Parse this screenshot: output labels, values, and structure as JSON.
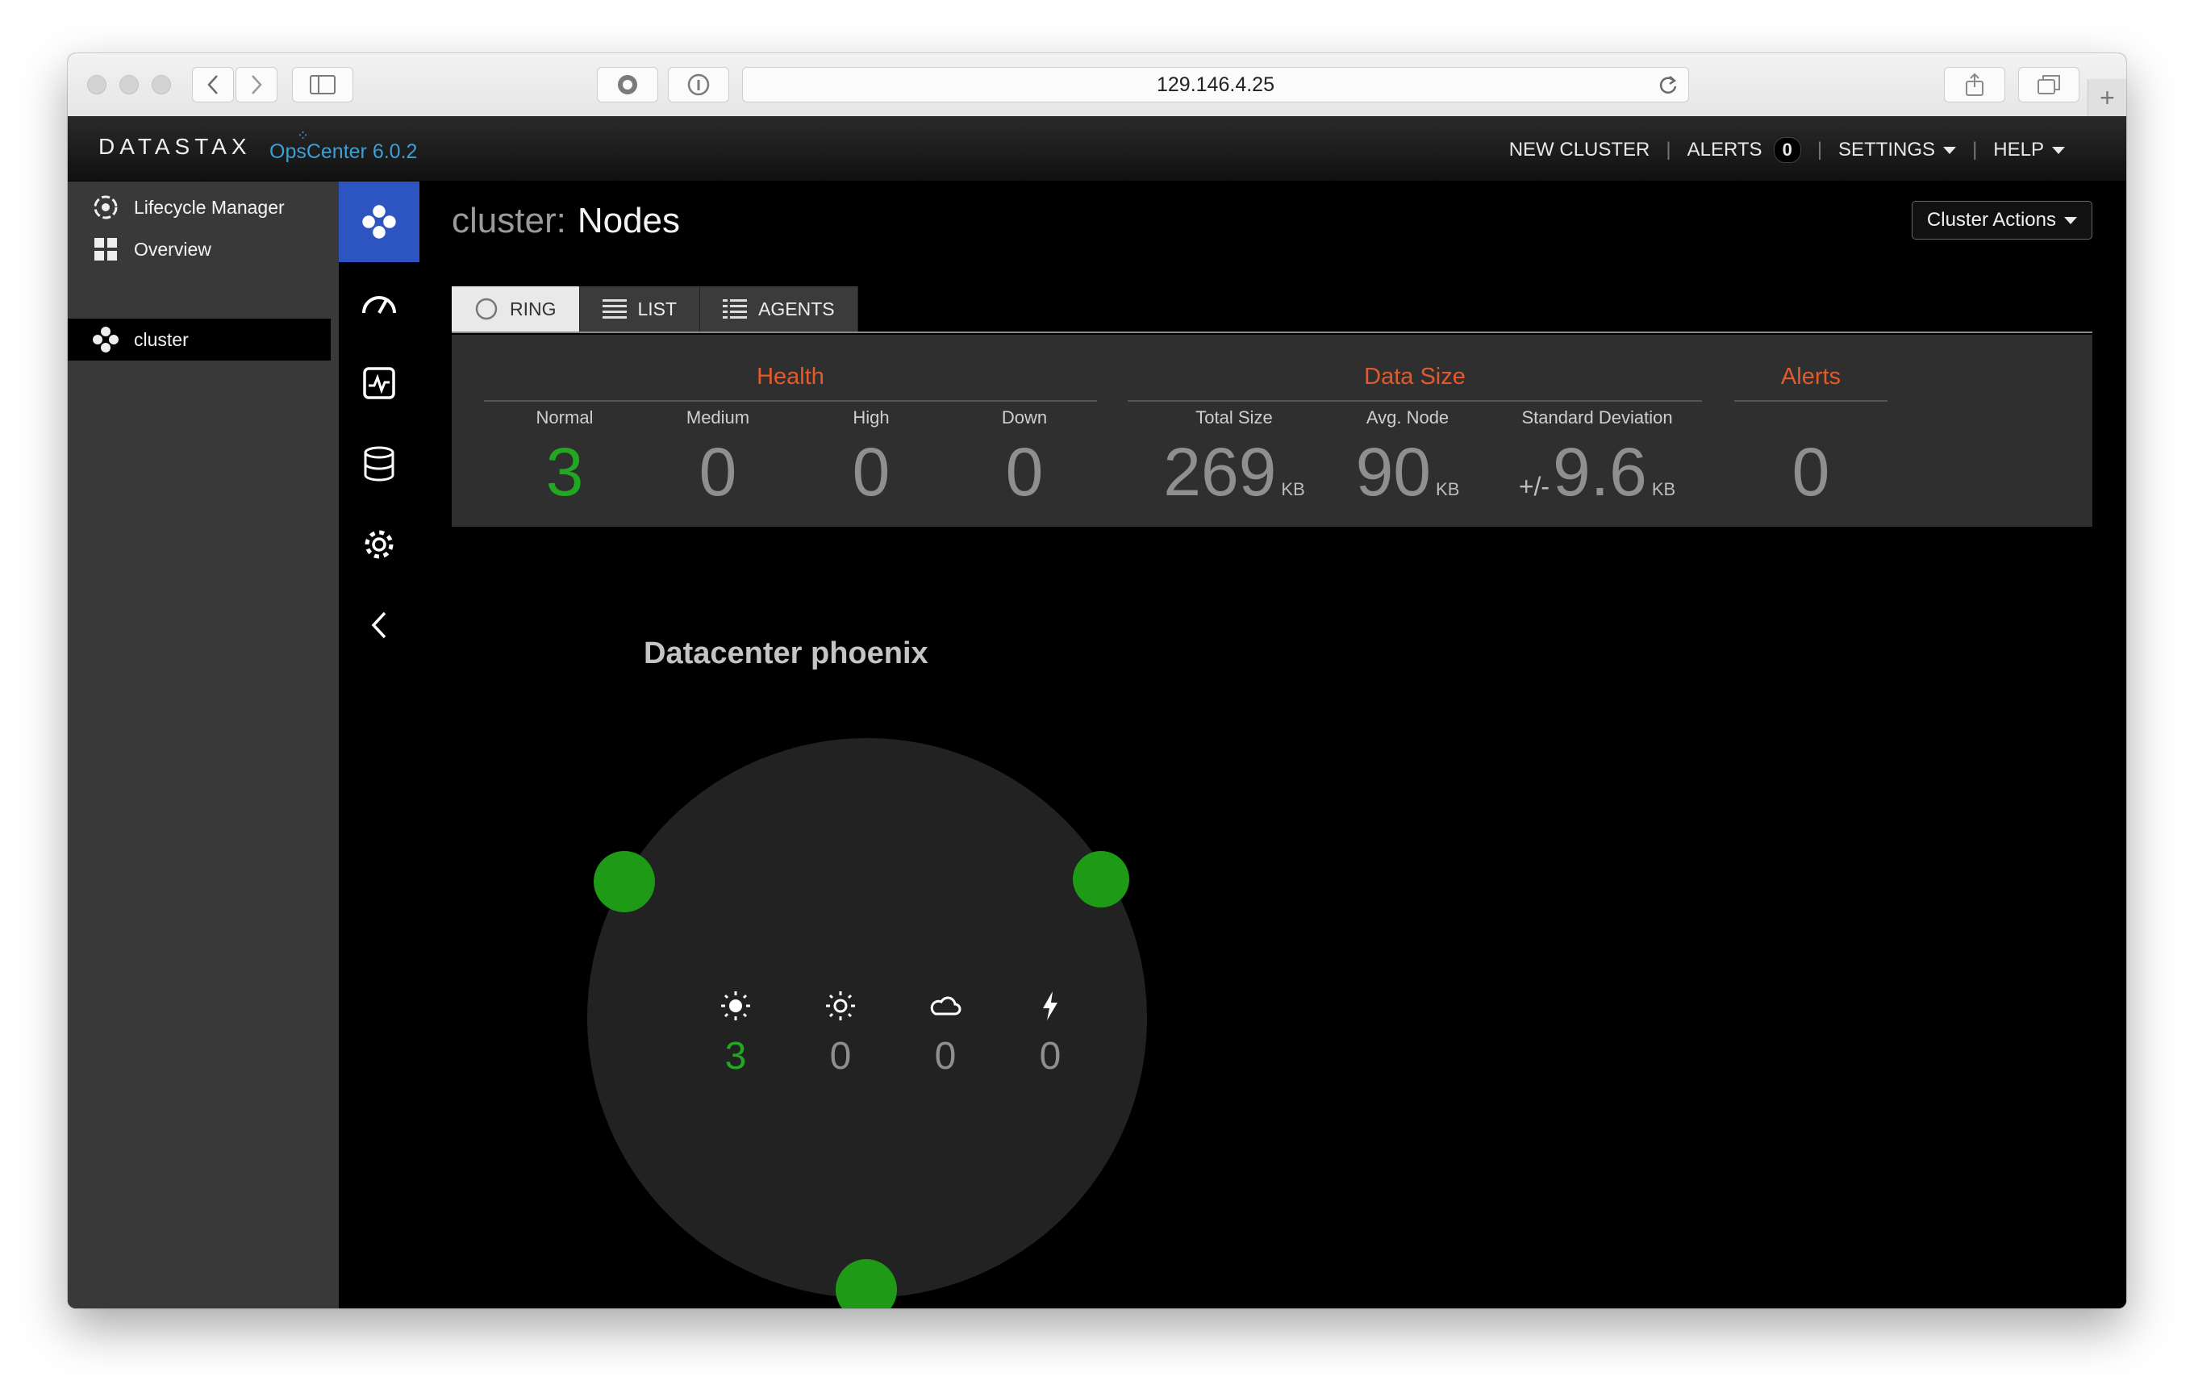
{
  "browser": {
    "url": "129.146.4.25"
  },
  "header": {
    "brand": "DATASTAX",
    "product": "OpsCenter 6.0.2",
    "nav": {
      "new_cluster": "NEW CLUSTER",
      "alerts": "ALERTS",
      "alerts_count": "0",
      "settings": "SETTINGS",
      "help": "HELP"
    }
  },
  "sidebar": {
    "items": [
      {
        "label": "Lifecycle Manager",
        "icon": "lifecycle-icon"
      },
      {
        "label": "Overview",
        "icon": "grid-icon"
      },
      {
        "label": "cluster",
        "icon": "cluster-icon",
        "active": true
      }
    ]
  },
  "rail": {
    "items": [
      "cluster-icon",
      "dashboard-gauge-icon",
      "monitor-chart-icon",
      "database-icon",
      "gear-icon",
      "collapse-chevron-icon"
    ]
  },
  "page": {
    "title_prefix": "cluster:",
    "title": "Nodes",
    "cluster_actions": "Cluster Actions",
    "tabs": [
      {
        "label": "RING",
        "icon": "ring-icon",
        "active": true
      },
      {
        "label": "LIST",
        "icon": "list-icon"
      },
      {
        "label": "AGENTS",
        "icon": "agents-icon"
      }
    ]
  },
  "stats": {
    "health": {
      "title": "Health",
      "normal": {
        "label": "Normal",
        "value": "3"
      },
      "medium": {
        "label": "Medium",
        "value": "0"
      },
      "high": {
        "label": "High",
        "value": "0"
      },
      "down": {
        "label": "Down",
        "value": "0"
      }
    },
    "data_size": {
      "title": "Data Size",
      "total": {
        "label": "Total Size",
        "value": "269",
        "unit": "KB"
      },
      "avg": {
        "label": "Avg. Node",
        "value": "90",
        "unit": "KB"
      },
      "stddev": {
        "label": "Standard Deviation",
        "prefix": "+/-",
        "value": "9.6",
        "unit": "KB"
      }
    },
    "alerts": {
      "title": "Alerts",
      "value": "0"
    }
  },
  "ring": {
    "datacenter": "Datacenter phoenix",
    "status": [
      {
        "icon": "sun-icon",
        "value": "3"
      },
      {
        "icon": "sun-outline-icon",
        "value": "0"
      },
      {
        "icon": "cloud-icon",
        "value": "0"
      },
      {
        "icon": "lightning-icon",
        "value": "0"
      }
    ],
    "node_color": "#1e9a16"
  },
  "colors": {
    "accent_orange": "#e35a2c",
    "active_blue": "#2d55c2",
    "healthy_green": "#22a722"
  }
}
